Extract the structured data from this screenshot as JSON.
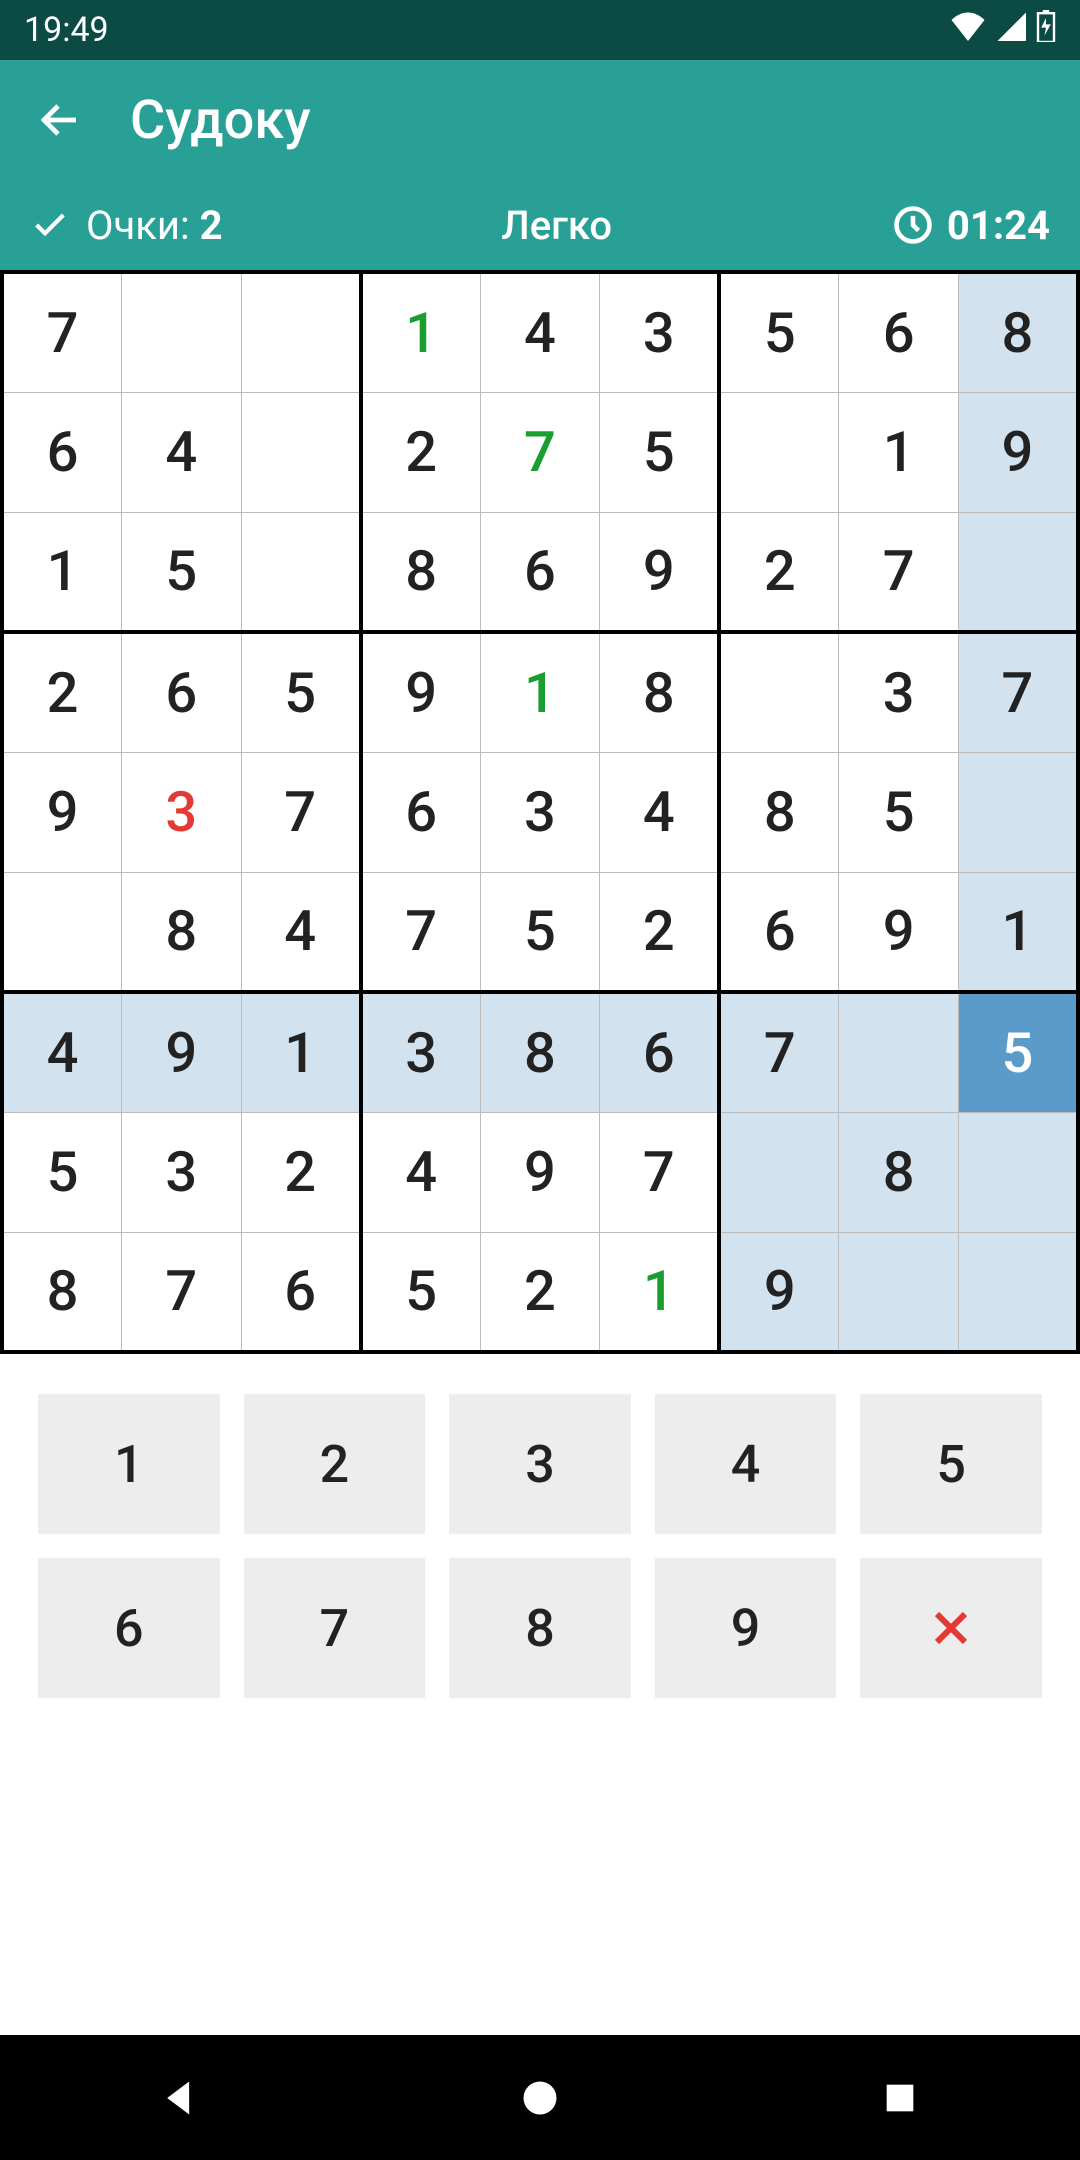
{
  "status": {
    "time": "19:49"
  },
  "header": {
    "title": "Судоку"
  },
  "info": {
    "score_label": "Очки: ",
    "score_value": "2",
    "difficulty": "Легко",
    "timer": "01:24"
  },
  "selected": [
    6,
    8
  ],
  "board": [
    [
      {
        "v": "7"
      },
      {
        "v": ""
      },
      {
        "v": ""
      },
      {
        "v": "1",
        "c": "green"
      },
      {
        "v": "4"
      },
      {
        "v": "3"
      },
      {
        "v": "5"
      },
      {
        "v": "6"
      },
      {
        "v": "8"
      }
    ],
    [
      {
        "v": "6"
      },
      {
        "v": "4"
      },
      {
        "v": ""
      },
      {
        "v": "2"
      },
      {
        "v": "7",
        "c": "green"
      },
      {
        "v": "5"
      },
      {
        "v": ""
      },
      {
        "v": "1"
      },
      {
        "v": "9"
      }
    ],
    [
      {
        "v": "1"
      },
      {
        "v": "5"
      },
      {
        "v": ""
      },
      {
        "v": "8"
      },
      {
        "v": "6"
      },
      {
        "v": "9"
      },
      {
        "v": "2"
      },
      {
        "v": "7"
      },
      {
        "v": ""
      }
    ],
    [
      {
        "v": "2"
      },
      {
        "v": "6"
      },
      {
        "v": "5"
      },
      {
        "v": "9"
      },
      {
        "v": "1",
        "c": "green"
      },
      {
        "v": "8"
      },
      {
        "v": ""
      },
      {
        "v": "3"
      },
      {
        "v": "7"
      }
    ],
    [
      {
        "v": "9"
      },
      {
        "v": "3",
        "c": "red"
      },
      {
        "v": "7"
      },
      {
        "v": "6"
      },
      {
        "v": "3"
      },
      {
        "v": "4"
      },
      {
        "v": "8"
      },
      {
        "v": "5"
      },
      {
        "v": ""
      }
    ],
    [
      {
        "v": ""
      },
      {
        "v": "8"
      },
      {
        "v": "4"
      },
      {
        "v": "7"
      },
      {
        "v": "5"
      },
      {
        "v": "2"
      },
      {
        "v": "6"
      },
      {
        "v": "9"
      },
      {
        "v": "1"
      }
    ],
    [
      {
        "v": "4"
      },
      {
        "v": "9"
      },
      {
        "v": "1"
      },
      {
        "v": "3"
      },
      {
        "v": "8"
      },
      {
        "v": "6"
      },
      {
        "v": "7"
      },
      {
        "v": ""
      },
      {
        "v": "5"
      }
    ],
    [
      {
        "v": "5"
      },
      {
        "v": "3"
      },
      {
        "v": "2"
      },
      {
        "v": "4"
      },
      {
        "v": "9"
      },
      {
        "v": "7"
      },
      {
        "v": ""
      },
      {
        "v": "8"
      },
      {
        "v": ""
      }
    ],
    [
      {
        "v": "8"
      },
      {
        "v": "7"
      },
      {
        "v": "6"
      },
      {
        "v": "5"
      },
      {
        "v": "2"
      },
      {
        "v": "1",
        "c": "green"
      },
      {
        "v": "9"
      },
      {
        "v": ""
      },
      {
        "v": ""
      }
    ]
  ],
  "keypad": {
    "k1": "1",
    "k2": "2",
    "k3": "3",
    "k4": "4",
    "k5": "5",
    "k6": "6",
    "k7": "7",
    "k8": "8",
    "k9": "9"
  }
}
